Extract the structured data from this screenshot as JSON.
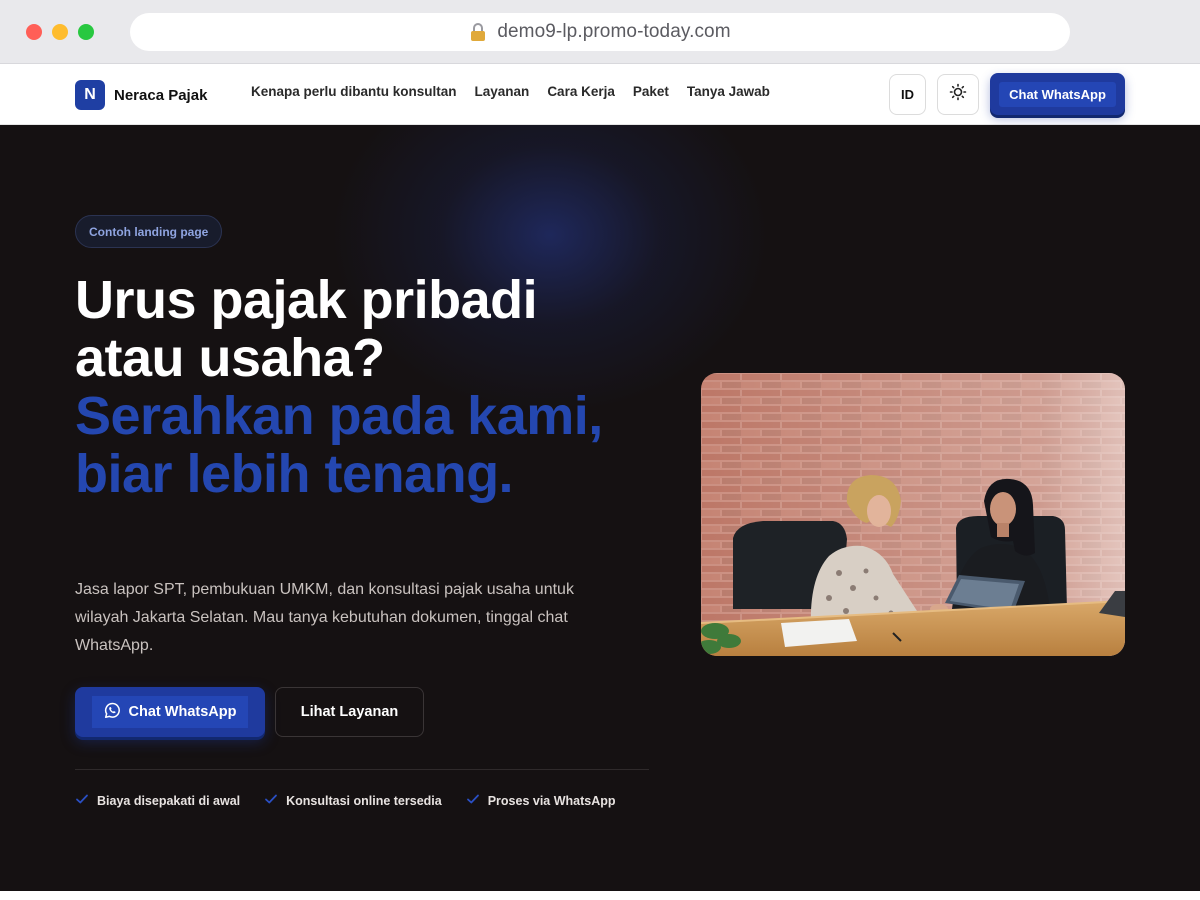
{
  "browser": {
    "url": "demo9-lp.promo-today.com"
  },
  "navbar": {
    "brand_initial": "N",
    "brand_name": "Neraca Pajak",
    "links": [
      {
        "label": "Kenapa perlu dibantu konsultan"
      },
      {
        "label": "Layanan"
      },
      {
        "label": "Cara Kerja"
      },
      {
        "label": "Paket"
      },
      {
        "label": "Tanya Jawab"
      }
    ],
    "lang_label": "ID",
    "theme_icon": "sun-icon",
    "cta_label": "Chat WhatsApp"
  },
  "hero": {
    "badge": "Contoh landing page",
    "headline_plain": "Urus pajak pribadi atau usaha? ",
    "headline_accent": "Serahkan pada kami, biar lebih tenang.",
    "lead": "Jasa lapor SPT, pembukuan UMKM, dan konsultasi pajak usaha untuk wilayah Jakarta Selatan. Mau tanya kebutuhan dokumen, tinggal chat WhatsApp.",
    "primary_button": {
      "label": "Chat WhatsApp",
      "icon": "whatsapp-icon"
    },
    "secondary_button": {
      "label": "Lihat Layanan"
    },
    "features": [
      {
        "label": "Biaya disepakati di awal",
        "icon": "check-icon"
      },
      {
        "label": "Konsultasi online tersedia",
        "icon": "check-icon"
      },
      {
        "label": "Proses via WhatsApp",
        "icon": "check-icon"
      }
    ]
  },
  "colors": {
    "brand_blue": "#1f3a9e",
    "accent_blue": "#2447b0",
    "hero_bg": "#151112",
    "badge_text": "#8fa4e0"
  }
}
